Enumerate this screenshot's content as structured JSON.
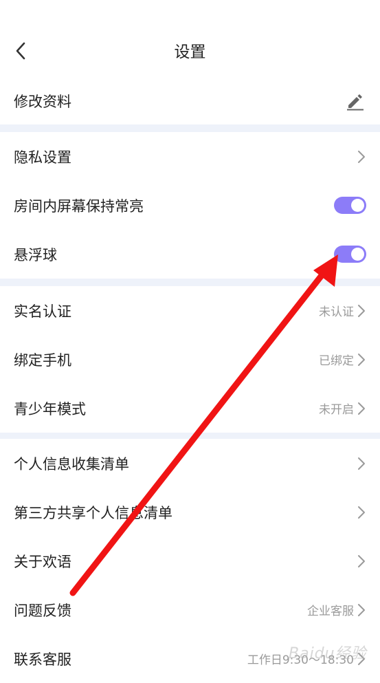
{
  "header": {
    "title": "设置",
    "back_icon": "chevron-left-icon"
  },
  "profile": {
    "edit_label": "修改资料",
    "icon": "pencil-icon"
  },
  "group1": {
    "privacy": {
      "label": "隐私设置"
    },
    "screen_on": {
      "label": "房间内屏幕保持常亮",
      "enabled": true
    },
    "floating_ball": {
      "label": "悬浮球",
      "enabled": true
    }
  },
  "group2": {
    "realname": {
      "label": "实名认证",
      "value": "未认证"
    },
    "bind_phone": {
      "label": "绑定手机",
      "value": "已绑定"
    },
    "teen_mode": {
      "label": "青少年模式",
      "value": "未开启"
    }
  },
  "group3": {
    "info_list": {
      "label": "个人信息收集清单"
    },
    "third_party": {
      "label": "第三方共享个人信息清单"
    },
    "about": {
      "label": "关于欢语"
    },
    "feedback": {
      "label": "问题反馈",
      "value": "企业客服"
    },
    "contact": {
      "label": "联系客服",
      "value": "工作日9:30～18:30"
    }
  },
  "watermark": "Baidu经验",
  "colors": {
    "accent": "#8c7cf8",
    "separator": "#eef2fa",
    "arrow": "#f01414",
    "muted": "#9a9a9a"
  }
}
